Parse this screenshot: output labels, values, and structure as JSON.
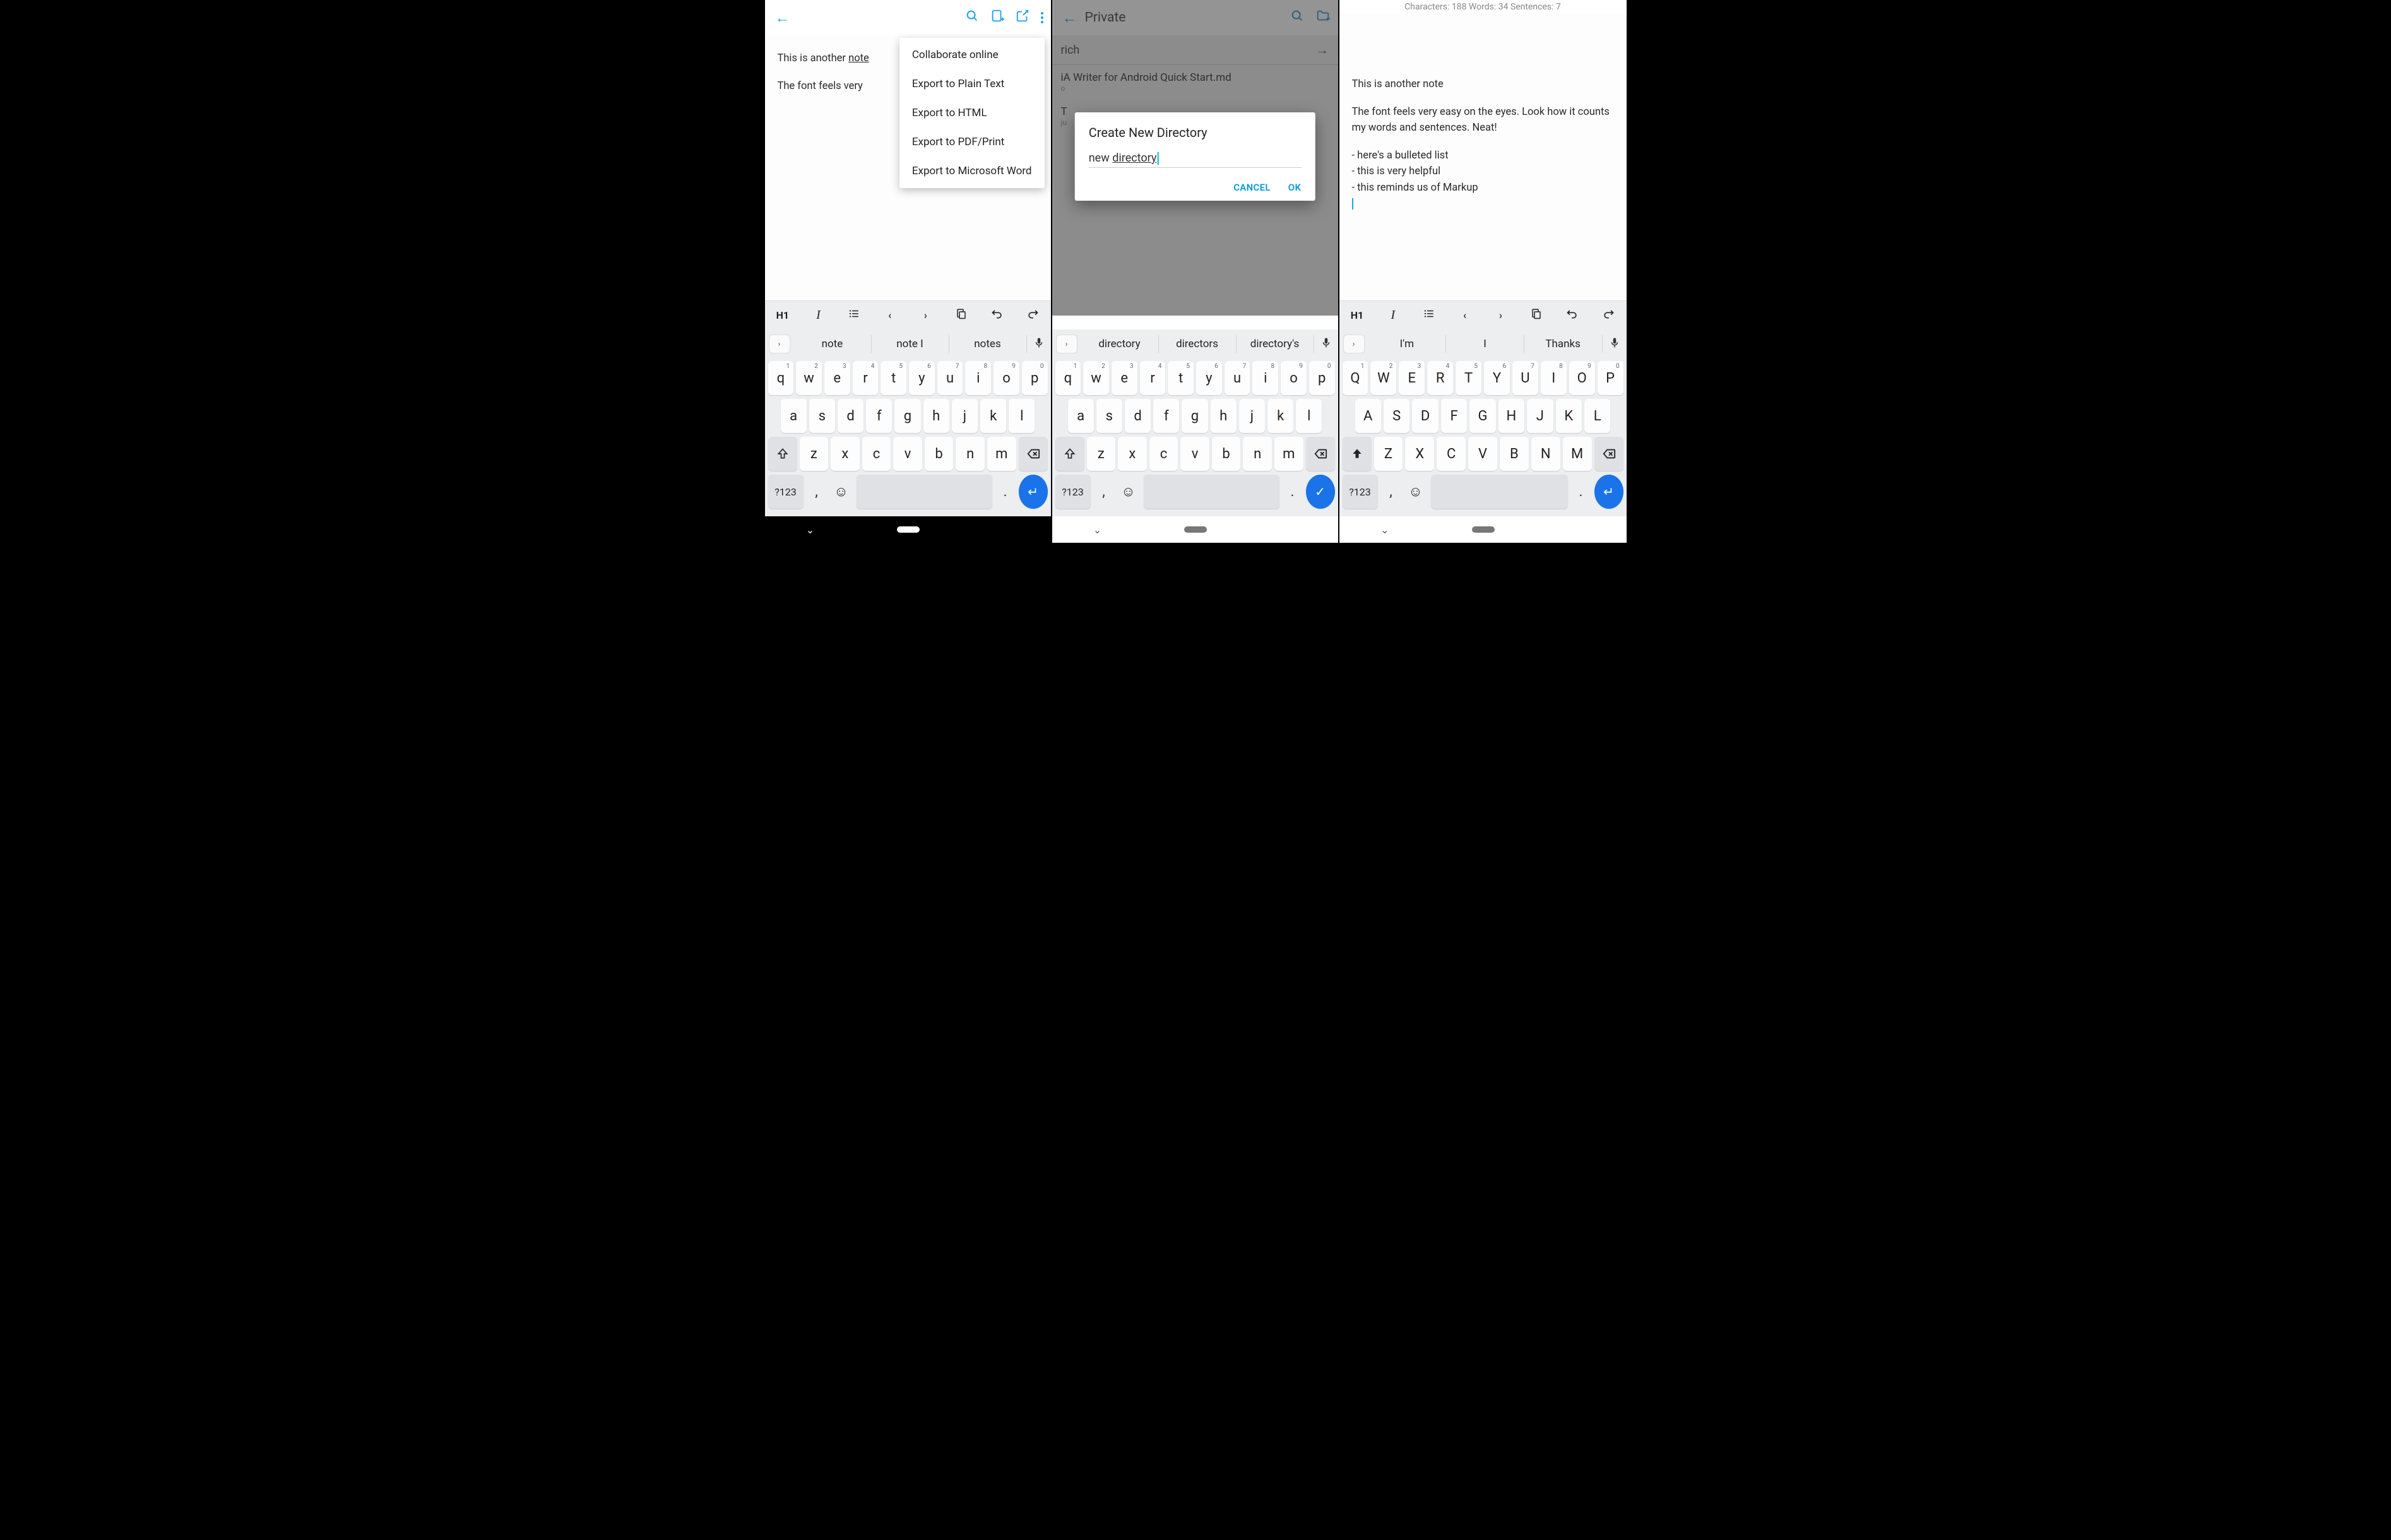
{
  "panel1": {
    "editor_line1_a": "This is another ",
    "editor_line1_b": "note",
    "editor_line2": "The font feels very",
    "menu": [
      "Collaborate online",
      "Export to Plain Text",
      "Export to HTML",
      "Export to PDF/Print",
      "Export to Microsoft Word"
    ],
    "format_bar": {
      "h1": "H1",
      "italic": "I",
      "list": "≡",
      "prev": "‹",
      "next": "›",
      "copy": "❐",
      "undo": "↶",
      "redo": "↷"
    },
    "suggestions": [
      "note",
      "note I",
      "notes"
    ],
    "kb_r1": [
      [
        "q",
        "1"
      ],
      [
        "w",
        "2"
      ],
      [
        "e",
        "3"
      ],
      [
        "r",
        "4"
      ],
      [
        "t",
        "5"
      ],
      [
        "y",
        "6"
      ],
      [
        "u",
        "7"
      ],
      [
        "i",
        "8"
      ],
      [
        "o",
        "9"
      ],
      [
        "p",
        "0"
      ]
    ],
    "kb_r2": [
      "a",
      "s",
      "d",
      "f",
      "g",
      "h",
      "j",
      "k",
      "l"
    ],
    "kb_r3": [
      "z",
      "x",
      "c",
      "v",
      "b",
      "n",
      "m"
    ],
    "kb_num": "?123",
    "kb_comma": ",",
    "kb_period": ".",
    "kb_emoji": "☺"
  },
  "panel2": {
    "title": "Private",
    "search_text": "rich",
    "file1_name": "iA Writer for Android Quick Start.md",
    "file1_meta": "o",
    "file2_name": "T",
    "file2_meta": "ju",
    "dialog_title": "Create New Directory",
    "dialog_input_a": "new ",
    "dialog_input_b": "directory",
    "dialog_cancel": "CANCEL",
    "dialog_ok": "OK",
    "suggestions": [
      "directory",
      "directors",
      "directory's"
    ],
    "kb_r1": [
      [
        "q",
        "1"
      ],
      [
        "w",
        "2"
      ],
      [
        "e",
        "3"
      ],
      [
        "r",
        "4"
      ],
      [
        "t",
        "5"
      ],
      [
        "y",
        "6"
      ],
      [
        "u",
        "7"
      ],
      [
        "i",
        "8"
      ],
      [
        "o",
        "9"
      ],
      [
        "p",
        "0"
      ]
    ],
    "kb_r2": [
      "a",
      "s",
      "d",
      "f",
      "g",
      "h",
      "j",
      "k",
      "l"
    ],
    "kb_r3": [
      "z",
      "x",
      "c",
      "v",
      "b",
      "n",
      "m"
    ],
    "kb_num": "?123",
    "kb_comma": ",",
    "kb_period": ".",
    "kb_emoji": "☺"
  },
  "panel3": {
    "stats": "Characters: 188 Words: 34 Sentences: 7",
    "line1": "This is another note",
    "para2": "The font feels very easy on the eyes. Look how it counts my words and sentences. Neat!",
    "bul1": "- here's a bulleted list",
    "bul2": "- this is very helpful",
    "bul3": "- this reminds us of Markup",
    "format_bar": {
      "h1": "H1",
      "italic": "I",
      "list": "≡",
      "prev": "‹",
      "next": "›",
      "copy": "❐",
      "undo": "↶",
      "redo": "↷"
    },
    "suggestions": [
      "I'm",
      "I",
      "Thanks"
    ],
    "kb_r1": [
      [
        "Q",
        "1"
      ],
      [
        "W",
        "2"
      ],
      [
        "E",
        "3"
      ],
      [
        "R",
        "4"
      ],
      [
        "T",
        "5"
      ],
      [
        "Y",
        "6"
      ],
      [
        "U",
        "7"
      ],
      [
        "I",
        "8"
      ],
      [
        "O",
        "9"
      ],
      [
        "P",
        "0"
      ]
    ],
    "kb_r2": [
      "A",
      "S",
      "D",
      "F",
      "G",
      "H",
      "J",
      "K",
      "L"
    ],
    "kb_r3": [
      "Z",
      "X",
      "C",
      "V",
      "B",
      "N",
      "M"
    ],
    "kb_num": "?123",
    "kb_comma": ",",
    "kb_period": ".",
    "kb_emoji": "☺"
  }
}
